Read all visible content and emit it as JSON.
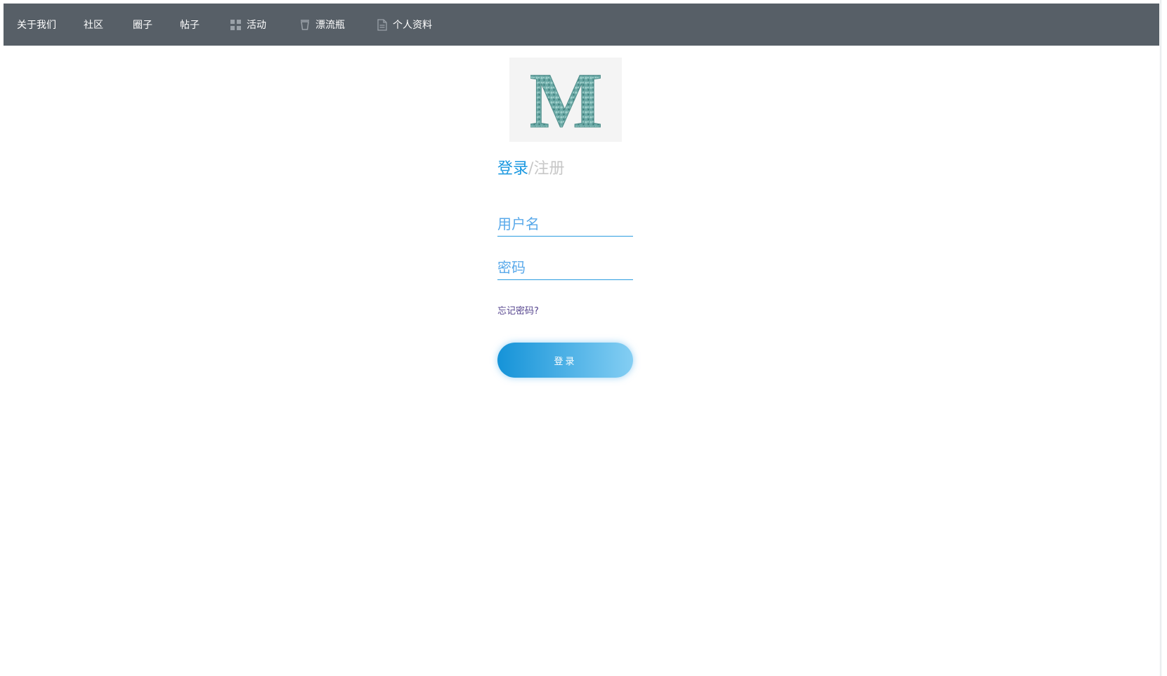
{
  "nav": {
    "items": [
      {
        "label": "关于我们",
        "icon": null
      },
      {
        "label": "社区",
        "icon": null
      },
      {
        "label": "圈子",
        "icon": null
      },
      {
        "label": "帖子",
        "icon": null
      },
      {
        "label": "活动",
        "icon": "grid-icon"
      },
      {
        "label": "漂流瓶",
        "icon": "cup-icon"
      },
      {
        "label": "个人资料",
        "icon": "document-icon"
      }
    ]
  },
  "logo": {
    "letter": "M",
    "color": "#6ba9a6"
  },
  "auth": {
    "tab_login": "登录",
    "separator": "/",
    "tab_register": "注册"
  },
  "form": {
    "username_placeholder": "用户名",
    "password_placeholder": "密码",
    "forgot_label": "忘记密码?",
    "submit_label": "登录"
  },
  "colors": {
    "navbar": "#575f67",
    "accent": "#1a98e0",
    "inactive_tab": "#c7c7c7",
    "link": "#55448e"
  }
}
